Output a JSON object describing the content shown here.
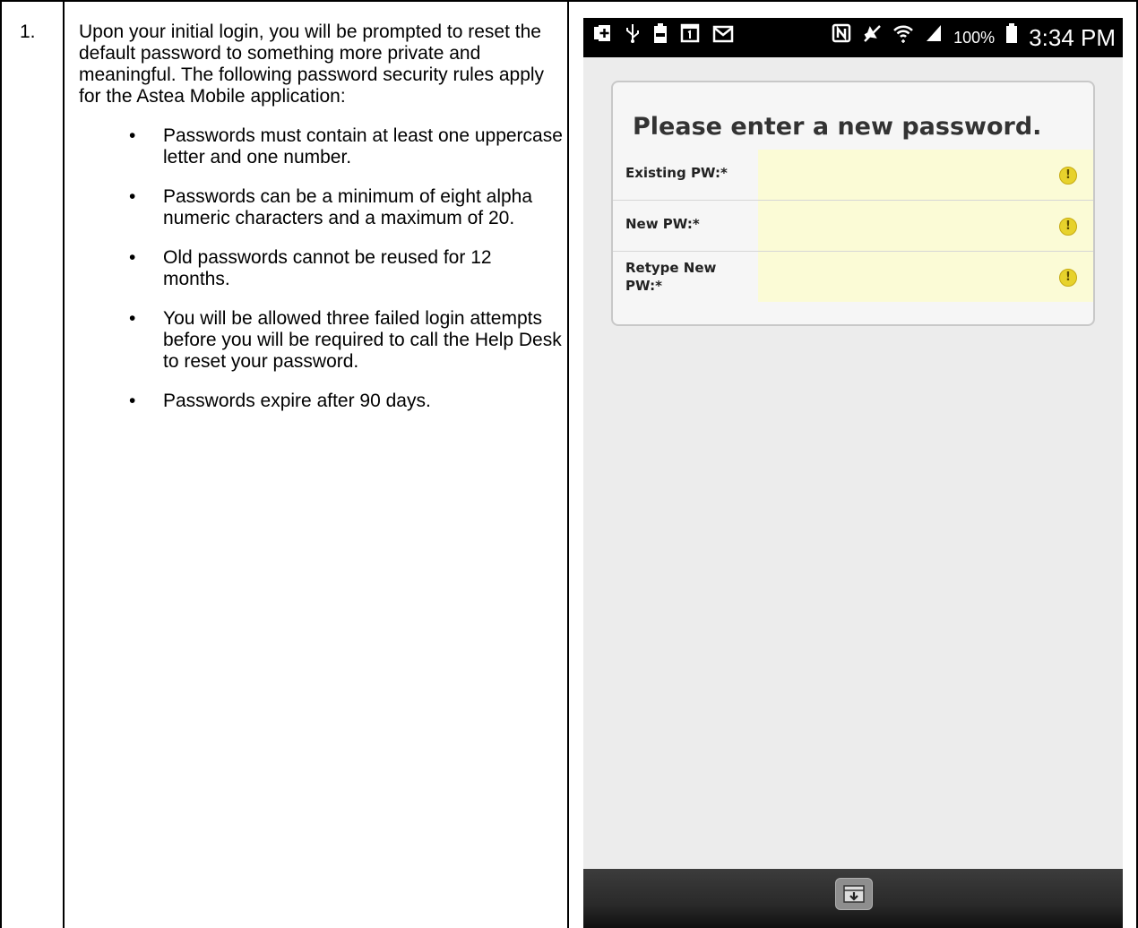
{
  "step": {
    "number": "1.",
    "intro": "Upon your initial login, you will be prompted to reset the default password to something more private and meaningful. The following password security rules apply for the Astea Mobile application:",
    "rules": [
      "Passwords must contain at least one uppercase letter and one number.",
      "Passwords can be a minimum of eight alpha numeric characters and a maximum of 20.",
      "Old passwords cannot be reused for 12 months.",
      "You will be allowed three failed login attempts before you will be required to call the Help Desk to reset your password.",
      "Passwords expire after 90 days."
    ],
    "bullet": "•"
  },
  "statusbar": {
    "icons_left": [
      "add-icon",
      "usb-icon",
      "battery-100-icon",
      "calendar-icon",
      "gmail-icon"
    ],
    "icons_right": [
      "nfc-icon",
      "mute-icon",
      "wifi-icon",
      "signal-icon"
    ],
    "battery": "100%",
    "time": "3:34 PM"
  },
  "form": {
    "title": "Please enter a new password.",
    "fields": [
      {
        "label": "Existing PW:*",
        "value": ""
      },
      {
        "label": "New PW:*",
        "value": ""
      },
      {
        "label": "Retype New PW:*",
        "value": ""
      }
    ],
    "warning_glyph": "!",
    "field_color": "#fbfbd6"
  },
  "footer": {
    "button_icon": "download-icon"
  }
}
